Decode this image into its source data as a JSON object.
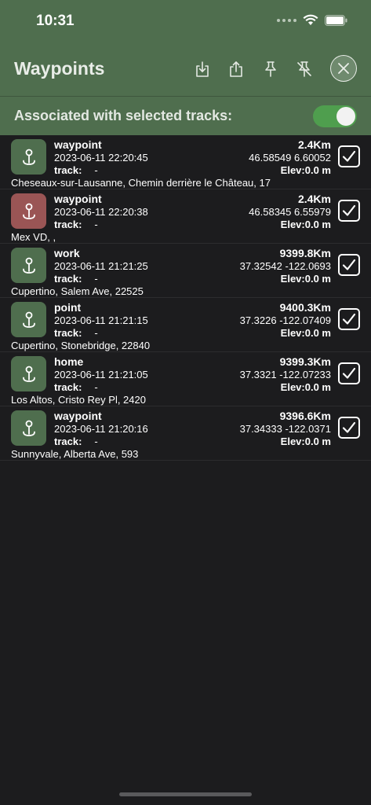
{
  "status": {
    "time": "10:31"
  },
  "header": {
    "title": "Waypoints"
  },
  "assoc": {
    "label": "Associated with selected tracks:",
    "toggle_on": true
  },
  "colors": {
    "header_bg": "#4f6e4e",
    "accent_green": "#4f9e4e",
    "marker_green": "#4f6e4e",
    "marker_red": "#9a5555"
  },
  "waypoints": [
    {
      "name": "waypoint",
      "date": "2023-06-11 22:20:45",
      "track_label": "track:",
      "track": "-",
      "address": "Cheseaux-sur-Lausanne, Chemin derrière le Château, 17",
      "distance": "2.4Km",
      "coords": "46.58549 6.60052",
      "elev": "Elev:0.0 m",
      "icon_color": "green",
      "checked": true
    },
    {
      "name": "waypoint",
      "date": "2023-06-11 22:20:38",
      "track_label": "track:",
      "track": "-",
      "address": "Mex VD, ,",
      "distance": "2.4Km",
      "coords": "46.58345 6.55979",
      "elev": "Elev:0.0 m",
      "icon_color": "red",
      "checked": true
    },
    {
      "name": "work",
      "date": "2023-06-11 21:21:25",
      "track_label": "track:",
      "track": "-",
      "address": "Cupertino, Salem Ave, 22525",
      "distance": "9399.8Km",
      "coords": "37.32542 -122.0693",
      "elev": "Elev:0.0 m",
      "icon_color": "green",
      "checked": true
    },
    {
      "name": "point",
      "date": "2023-06-11 21:21:15",
      "track_label": "track:",
      "track": "-",
      "address": "Cupertino, Stonebridge, 22840",
      "distance": "9400.3Km",
      "coords": "37.3226 -122.07409",
      "elev": "Elev:0.0 m",
      "icon_color": "green",
      "checked": true
    },
    {
      "name": "home",
      "date": "2023-06-11 21:21:05",
      "track_label": "track:",
      "track": "-",
      "address": "Los Altos, Cristo Rey Pl, 2420",
      "distance": "9399.3Km",
      "coords": "37.3321 -122.07233",
      "elev": "Elev:0.0 m",
      "icon_color": "green",
      "checked": true
    },
    {
      "name": "waypoint",
      "date": "2023-06-11 21:20:16",
      "track_label": "track:",
      "track": "-",
      "address": "Sunnyvale, Alberta Ave, 593",
      "distance": "9396.6Km",
      "coords": "37.34333 -122.0371",
      "elev": "Elev:0.0 m",
      "icon_color": "green",
      "checked": true
    }
  ]
}
